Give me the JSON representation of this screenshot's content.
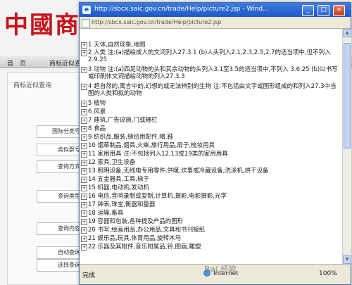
{
  "background": {
    "logo_text": "中國商标",
    "nav": [
      "首　页",
      "商标近似查"
    ],
    "panel_title": "商标近似查询",
    "form_rows": [
      "国际分类号：",
      "类似群号：",
      "查询方式：",
      "查询类型：",
      "查询内容：",
      "自动查询：",
      "选择查询："
    ]
  },
  "window": {
    "title": "http://sbcx.saic.gov.cn/trade/Help/picture2.jsp - Wind...",
    "url": "http://sbcx.saic.gov.cn/trade/Help/picture2.jsp",
    "minimize": "_",
    "maximize": "□",
    "close": "×",
    "expand_symbol": "+",
    "items": [
      "1 天体,自然现象,地图",
      "2 人类 注:(a)描绘成人的文词列入27.3.1 (b)人头列入2.1,2.3,2.5,2.7的适当项中,但不列入2.9.25",
      "3 动物 注:(a)四足动物的头和其余动物的头列入3.1至3.5的适当项中,不列入 3.6.25 (b)以书写或印刷体文词描绘动物的列入27.3.3",
      "4 超自然的,寓言中的,幻想的或无法辨别的生物 注:不包括由文字或图形组成的和列入27.3中当图的人类和拟的动物",
      "5 植物",
      "6 风景",
      "7 建筑,广告设施,门或栅栏",
      "8 食品",
      "9 纺织品,服装,缝纫用配件,帽,鞋",
      "10 烟草制品,烟具,火柴,旅行用品,扇子,梳妆用具",
      "11 家用用具 注:不包括列入12,13或19类的家用用具",
      "12 家具,卫生设备",
      "13 照明设备,无线电专用零件,供暖,炊事或冷藏设备,洗涤机,烘干设备",
      "14 五金器具,工具,梯子",
      "15 机器,电动机,发动机",
      "16 电信,音响录制或复制,计算机,摄影,电影摄影,光学",
      "17 钟表,珠宝,衡器和量器",
      "18 运输,畜具",
      "19 容器和包装,各种提及产品的图形",
      "20 书写,绘画用品,办公用品,文具和书刊报纸",
      "21 娱乐品,玩具,体育用品,旋转木马",
      "22 乐器及其附件,音乐附属品,铃,图画,雕塑"
    ],
    "status": "完成",
    "zone": "Internet",
    "zoom": "100%",
    "watermark": "Bai 经验"
  }
}
